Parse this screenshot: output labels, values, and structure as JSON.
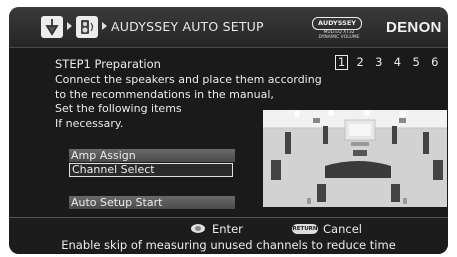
{
  "header": {
    "title": "AUDYSSEY AUTO SETUP",
    "audyssey_badge": "AUDYSSEY",
    "audyssey_sub_1": "MULTEQ XT32",
    "audyssey_sub_2": "DYNAMIC VOLUME",
    "brand": "DENON",
    "icons": [
      "setup-menu-icon",
      "speaker-icon"
    ]
  },
  "step": {
    "title": "STEP1 Preparation",
    "numbers": [
      "1",
      "2",
      "3",
      "4",
      "5",
      "6"
    ],
    "current": "1"
  },
  "instructions": [
    "Connect the speakers and place them according",
    "to the recommendations in the manual,",
    "Set the following items",
    "If necessary."
  ],
  "menu": {
    "items": [
      "Amp Assign",
      "Channel Select",
      "Auto Setup Start"
    ],
    "selected": "Channel Select"
  },
  "footer": {
    "enter_label": "Enter",
    "return_badge": "RETURN",
    "cancel_label": "Cancel",
    "description": "Enable skip of measuring unused channels to reduce time"
  },
  "colors": {
    "screen_bg": "#1a1a1a",
    "text": "#ececec",
    "menu_item_bg": "#5a5a5a"
  }
}
